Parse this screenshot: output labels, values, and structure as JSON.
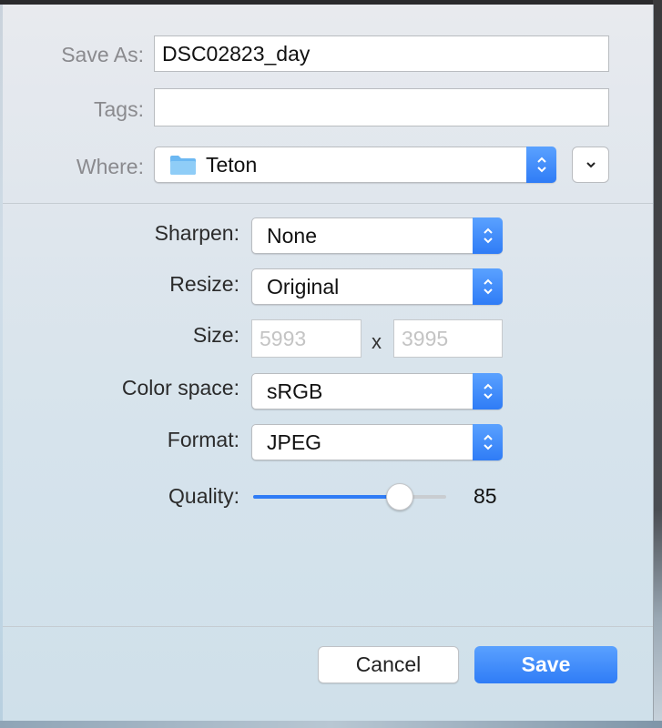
{
  "save_as": {
    "label": "Save As:",
    "value": "DSC02823_day"
  },
  "tags": {
    "label": "Tags:",
    "value": ""
  },
  "where": {
    "label": "Where:",
    "value": "Teton",
    "icon": "folder-icon"
  },
  "options": {
    "sharpen": {
      "label": "Sharpen:",
      "value": "None"
    },
    "resize": {
      "label": "Resize:",
      "value": "Original"
    },
    "size": {
      "label": "Size:",
      "width_placeholder": "5993",
      "separator": "x",
      "height_placeholder": "3995"
    },
    "color_space": {
      "label": "Color space:",
      "value": "sRGB"
    },
    "format": {
      "label": "Format:",
      "value": "JPEG"
    },
    "quality": {
      "label": "Quality:",
      "value": "85",
      "level": 0.76
    }
  },
  "buttons": {
    "cancel": "Cancel",
    "save": "Save"
  },
  "colors": {
    "accent": "#2f7cf6",
    "accent_light": "#5aa1ff"
  }
}
